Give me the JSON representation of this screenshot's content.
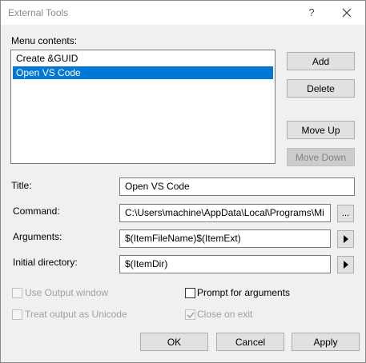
{
  "window": {
    "title": "External Tools",
    "help_glyph": "?"
  },
  "menu": {
    "label": "Menu contents:",
    "items": [
      {
        "label": "Create &GUID"
      },
      {
        "label": "Open VS Code"
      }
    ]
  },
  "side_buttons": {
    "add": "Add",
    "delete": "Delete",
    "move_up": "Move Up",
    "move_down": "Move Down"
  },
  "fields": {
    "title_label": "Title:",
    "title_value": "Open VS Code",
    "command_label": "Command:",
    "command_value": "C:\\Users\\machine\\AppData\\Local\\Programs\\Mi",
    "command_browse": "...",
    "arguments_label": "Arguments:",
    "arguments_value": "$(ItemFileName)$(ItemExt)",
    "initial_dir_label": "Initial directory:",
    "initial_dir_value": "$(ItemDir)",
    "arrow_glyph": "▶"
  },
  "options": {
    "use_output": {
      "label": "Use Output window",
      "checked": false,
      "enabled": false
    },
    "prompt_args": {
      "label": "Prompt for arguments",
      "checked": false,
      "enabled": true
    },
    "treat_unicode": {
      "label": "Treat output as Unicode",
      "checked": false,
      "enabled": false
    },
    "close_on_exit": {
      "label": "Close on exit",
      "checked": true,
      "enabled": false
    }
  },
  "footer": {
    "ok": "OK",
    "cancel": "Cancel",
    "apply": "Apply"
  },
  "colors": {
    "selection": "#0078d7",
    "dialog_bg": "#f0f0f0"
  }
}
